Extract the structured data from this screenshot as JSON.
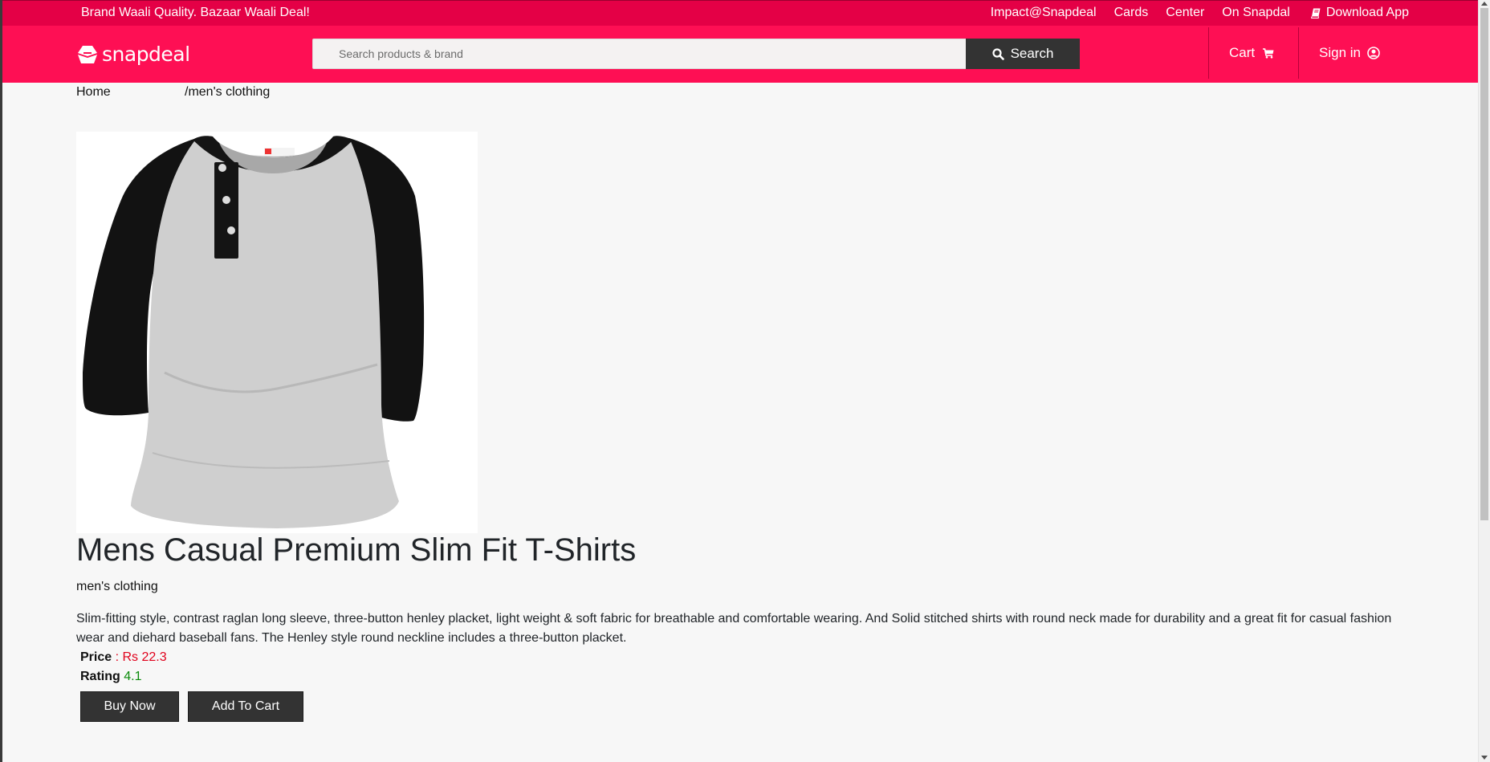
{
  "topbar": {
    "tagline": "Brand Waali Quality. Bazaar Waali Deal!",
    "links": [
      "Impact@Snapdeal",
      "Cards",
      "Center",
      "On Snapdal"
    ],
    "download_label": "Download App",
    "download_icon": "book-icon"
  },
  "header": {
    "logo_text": "snapdeal",
    "search_placeholder": "Search products & brand",
    "search_button_label": "Search",
    "cart_label": "Cart",
    "signin_label": "Sign in"
  },
  "breadcrumb": {
    "home": "Home",
    "category": "/men's clothing"
  },
  "product": {
    "image_description": "raglan henley t-shirt",
    "title": "Mens Casual Premium Slim Fit T-Shirts",
    "category": "men's clothing",
    "description": "Slim-fitting style, contrast raglan long sleeve, three-button henley placket, light weight & soft fabric for breathable and comfortable wearing. And Solid stitched shirts with round neck made for durability and a great fit for casual fashion wear and diehard baseball fans. The Henley style round neckline includes a three-button placket.",
    "price_label": "Price",
    "price_value": ": Rs 22.3",
    "rating_label": "Rating",
    "rating_value": "4.1",
    "buy_now_label": "Buy Now",
    "add_to_cart_label": "Add To Cart"
  },
  "colors": {
    "topbar": "#e40046",
    "navbar": "#fe0f54",
    "dark_button": "#333333",
    "price": "#e0001b",
    "rating": "#0a8a0a"
  }
}
